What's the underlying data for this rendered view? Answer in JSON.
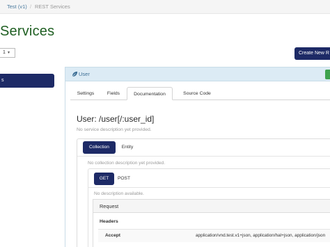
{
  "breadcrumb": {
    "items": [
      "Test (v1)",
      "REST Services"
    ],
    "separator": "/"
  },
  "page_title": "Services",
  "page_size_select": {
    "value": "1"
  },
  "create_button": {
    "label": "Create New R"
  },
  "sidebar": {
    "selected_item": "s"
  },
  "service_panel": {
    "icon": "leaf-icon",
    "title": "User",
    "tabs": [
      {
        "label": "Settings",
        "active": false
      },
      {
        "label": "Fields",
        "active": false
      },
      {
        "label": "Documentation",
        "active": true
      },
      {
        "label": "Source Code",
        "active": false
      }
    ],
    "service_name": "User: /user[/:user_id]",
    "service_description": "No service description yet provided.",
    "collection_tabs": [
      {
        "label": "Collection",
        "active": true
      },
      {
        "label": "Entity",
        "active": false
      }
    ],
    "collection_description": "No collection description yet provided.",
    "method_tabs": [
      {
        "label": "GET",
        "active": true
      },
      {
        "label": "POST",
        "active": false
      }
    ],
    "method_description": "No description available.",
    "request": {
      "heading": "Request",
      "headers_label": "Headers",
      "rows": [
        {
          "name": "Accept",
          "value": "application/vnd.test.v1+json, application/hal+json, application/json"
        }
      ]
    }
  },
  "colors": {
    "title_green": "#1f5f22",
    "primary_navy": "#1d2a66",
    "panel_header": "#dcebf5",
    "accent_green": "#3ea34e"
  }
}
